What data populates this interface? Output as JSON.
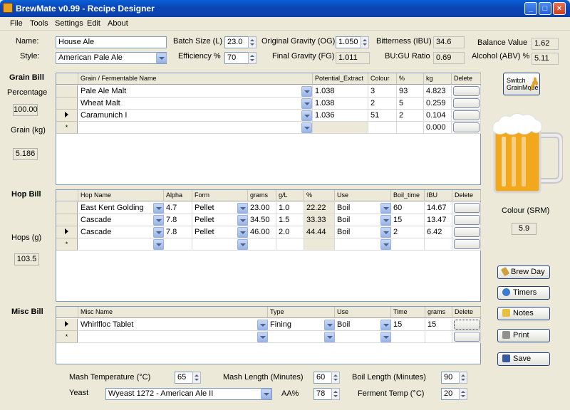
{
  "window": {
    "title": "BrewMate v0.99 - Recipe Designer",
    "min": "_",
    "max": "□",
    "close": "×"
  },
  "menu": [
    "File",
    "Tools",
    "Settings",
    "Edit",
    "About"
  ],
  "recipe": {
    "name_label": "Name:",
    "name": "House Ale",
    "style_label": "Style:",
    "style": "American Pale Ale",
    "batch_label": "Batch Size (L)",
    "batch": "23.0",
    "eff_label": "Efficiency %",
    "eff": "70",
    "og_label": "Original Gravity (OG)",
    "og": "1.050",
    "fg_label": "Final Gravity (FG)",
    "fg": "1.011",
    "ibu_label": "Bitterness (IBU)",
    "ibu": "34.6",
    "bugu_label": "BU:GU Ratio",
    "bugu": "0.69",
    "balance_label": "Balance Value",
    "balance": "1.62",
    "abv_label": "Alcohol (ABV) %",
    "abv": "5.11"
  },
  "grain": {
    "title": "Grain Bill",
    "pct_label": "Percentage",
    "pct": "100.00",
    "kg_label": "Grain (kg)",
    "kg": "5.186",
    "headers": [
      "Grain / Fermentable Name",
      "Potential_Extract",
      "Colour",
      "%",
      "kg",
      "Delete"
    ],
    "rows": [
      {
        "name": "Pale Ale Malt",
        "extract": "1.038",
        "colour": "3",
        "pct": "93",
        "kg": "4.823"
      },
      {
        "name": "Wheat Malt",
        "extract": "1.038",
        "colour": "2",
        "pct": "5",
        "kg": "0.259"
      },
      {
        "name": "Caramunich I",
        "extract": "1.036",
        "colour": "51",
        "pct": "2",
        "kg": "0.104"
      },
      {
        "name": "",
        "extract": "",
        "colour": "",
        "pct": "",
        "kg": "0.000"
      }
    ],
    "new_marker": "*"
  },
  "hops": {
    "title": "Hop Bill",
    "g_label": "Hops (g)",
    "g": "103.5",
    "headers": [
      "Hop Name",
      "Alpha",
      "Form",
      "grams",
      "g/L",
      "%",
      "Use",
      "Boil_time",
      "IBU",
      "Delete"
    ],
    "rows": [
      {
        "name": "East Kent Golding",
        "alpha": "4.7",
        "form": "Pellet",
        "grams": "23.00",
        "gl": "1.0",
        "pct": "22.22",
        "use": "Boil",
        "time": "60",
        "ibu": "14.67"
      },
      {
        "name": "Cascade",
        "alpha": "7.8",
        "form": "Pellet",
        "grams": "34.50",
        "gl": "1.5",
        "pct": "33.33",
        "use": "Boil",
        "time": "15",
        "ibu": "13.47"
      },
      {
        "name": "Cascade",
        "alpha": "7.8",
        "form": "Pellet",
        "grams": "46.00",
        "gl": "2.0",
        "pct": "44.44",
        "use": "Boil",
        "time": "2",
        "ibu": "6.42"
      },
      {
        "name": "",
        "alpha": "",
        "form": "",
        "grams": "",
        "gl": "",
        "pct": "",
        "use": "",
        "time": "",
        "ibu": ""
      }
    ],
    "new_marker": "*"
  },
  "misc": {
    "title": "Misc Bill",
    "headers": [
      "Misc Name",
      "Type",
      "Use",
      "Time",
      "grams",
      "Delete"
    ],
    "rows": [
      {
        "name": "Whirlfloc Tablet",
        "type": "Fining",
        "use": "Boil",
        "time": "15",
        "grams": "15"
      },
      {
        "name": "",
        "type": "",
        "use": "",
        "time": "",
        "grams": ""
      }
    ],
    "new_marker": "*"
  },
  "side": {
    "switch_label": "Switch GrainMode",
    "colour_label": "Colour (SRM)",
    "colour": "5.9",
    "buttons": [
      "Brew Day",
      "Timers",
      "Notes",
      "Print",
      "Save"
    ]
  },
  "bottom": {
    "mash_temp_label": "Mash Temperature (°C)",
    "mash_temp": "65",
    "mash_len_label": "Mash Length (Minutes)",
    "mash_len": "60",
    "boil_len_label": "Boil Length (Minutes)",
    "boil_len": "90",
    "yeast_label": "Yeast",
    "yeast": "Wyeast 1272 - American Ale II",
    "aa_label": "AA%",
    "aa": "78",
    "ferm_label": "Ferment Temp (°C)",
    "ferm": "20"
  },
  "colors": {
    "beer": "#f2a81c",
    "foam": "#ffffff",
    "accent": "#0a47b8"
  }
}
